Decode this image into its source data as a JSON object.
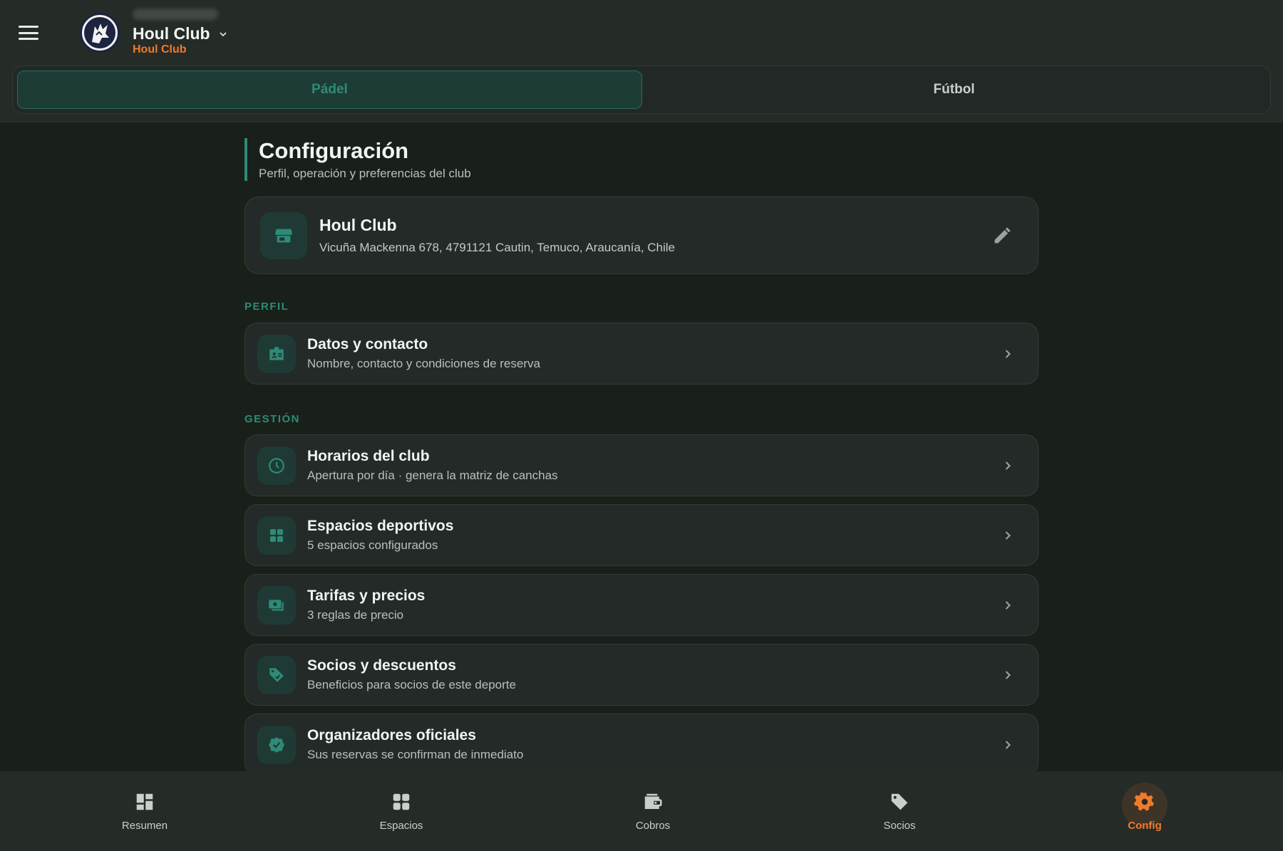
{
  "header": {
    "club_title": "Houl Club",
    "club_subtitle": "Houl Club",
    "tabs": [
      {
        "label": "Pádel",
        "active": true
      },
      {
        "label": "Fútbol",
        "active": false
      }
    ]
  },
  "page": {
    "title": "Configuración",
    "subtitle": "Perfil, operación y preferencias del club"
  },
  "club_card": {
    "name": "Houl Club",
    "address": "Vicuña Mackenna 678, 4791121 Cautin, Temuco, Araucanía, Chile",
    "icon": "store-icon"
  },
  "sections": {
    "perfil": {
      "label": "PERFIL",
      "items": [
        {
          "title": "Datos y contacto",
          "subtitle": "Nombre, contacto y condiciones de reserva",
          "icon": "contact-card-icon"
        }
      ]
    },
    "gestion": {
      "label": "GESTIÓN",
      "items": [
        {
          "title": "Horarios del club",
          "subtitle": "Apertura por día · genera la matriz de canchas",
          "icon": "clock-icon"
        },
        {
          "title": "Espacios deportivos",
          "subtitle": "5 espacios configurados",
          "icon": "grid-icon"
        },
        {
          "title": "Tarifas y precios",
          "subtitle": "3 reglas de precio",
          "icon": "money-icon"
        },
        {
          "title": "Socios y descuentos",
          "subtitle": "Beneficios para socios de este deporte",
          "icon": "tag-icon"
        },
        {
          "title": "Organizadores oficiales",
          "subtitle": "Sus reservas se confirman de inmediato",
          "icon": "verified-icon"
        }
      ]
    }
  },
  "bottom_nav": [
    {
      "label": "Resumen",
      "icon": "dashboard-icon",
      "active": false
    },
    {
      "label": "Espacios",
      "icon": "grid-icon",
      "active": false
    },
    {
      "label": "Cobros",
      "icon": "wallet-icon",
      "active": false
    },
    {
      "label": "Socios",
      "icon": "tag-icon",
      "active": false
    },
    {
      "label": "Config",
      "icon": "gear-icon",
      "active": true
    }
  ],
  "colors": {
    "accent": "#2f8a78",
    "brand_orange": "#f07a2c",
    "background": "#192019",
    "surface": "#232a27"
  }
}
